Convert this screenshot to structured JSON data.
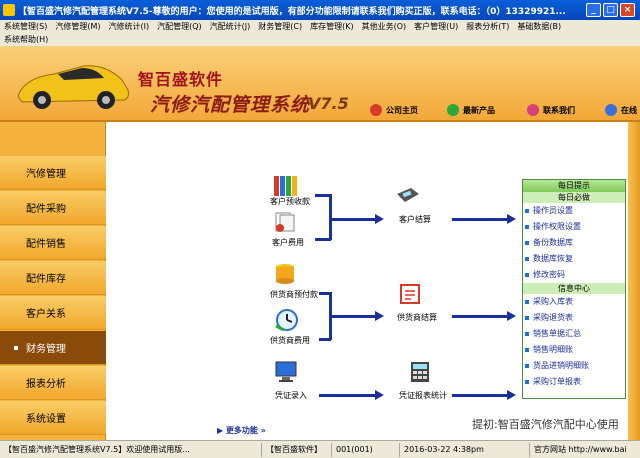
{
  "window": {
    "title": "【智百盛汽修汽配管理系统V7.5-尊敬的用户：您使用的是试用版，有部分功能限制请联系我们购买正版，联系电话：（0）13329921...",
    "min": "_",
    "max": "□",
    "close": "×"
  },
  "menu": {
    "row1": [
      "系统管理(S)",
      "汽修管理(M)",
      "汽修统计(I)",
      "汽配管理(Q)",
      "汽配统计(J)",
      "财务管理(C)",
      "库存管理(K)",
      "其他业务(O)",
      "客户管理(U)",
      "报表分析(T)",
      "基础数据(B)"
    ],
    "row2": [
      "系统帮助(H)"
    ]
  },
  "banner": {
    "brand_line1": "智百盛软件",
    "brand_line2": "汽修汽配管理系统",
    "version": "V7.5",
    "links": [
      {
        "label": "公司主页",
        "icon": "home-icon",
        "color": "#d83a2a"
      },
      {
        "label": "最新产品",
        "icon": "product-icon",
        "color": "#2aa83a"
      },
      {
        "label": "联系我们",
        "icon": "contact-icon",
        "color": "#d8407a"
      },
      {
        "label": "在线",
        "icon": "online-icon",
        "color": "#3a6fd8"
      }
    ]
  },
  "sidebar": {
    "items": [
      "汽修管理",
      "配件采购",
      "配件销售",
      "配件库存",
      "客户关系",
      "财务管理",
      "报表分析",
      "系统设置"
    ],
    "active_index": 5
  },
  "flow": {
    "customer_advance": "客户预收款",
    "customer_expense": "客户费用",
    "customer_settle": "客户结算",
    "supplier_advance": "供货商预付款",
    "supplier_expense": "供货商费用",
    "supplier_settle": "供货商结算",
    "voucher_entry": "凭证录入",
    "voucher_report": "凭证报表统计"
  },
  "tips": {
    "header": "每日提示",
    "daily_header": "每日必做",
    "daily_items": [
      "操作员设置",
      "操作权限设置",
      "备份数据库",
      "数据库恢复",
      "修改密码"
    ],
    "info_header": "信息中心",
    "info_items": [
      "采购入库表",
      "采购退货表",
      "销售单据汇总",
      "销售明细账",
      "货品进销明细账",
      "采购订单报表"
    ]
  },
  "more_link": "更多功能",
  "bottom_text": "提初:智百盛汽修汽配中心使用",
  "status": {
    "app": "【智百盛汽修汽配管理系统V7.5】欢迎使用试用版...",
    "company": "【智百盛软件】",
    "user": "001(001)",
    "datetime": "2016-03-22  4:38pm",
    "site": "官方网站 http://www.bai"
  }
}
